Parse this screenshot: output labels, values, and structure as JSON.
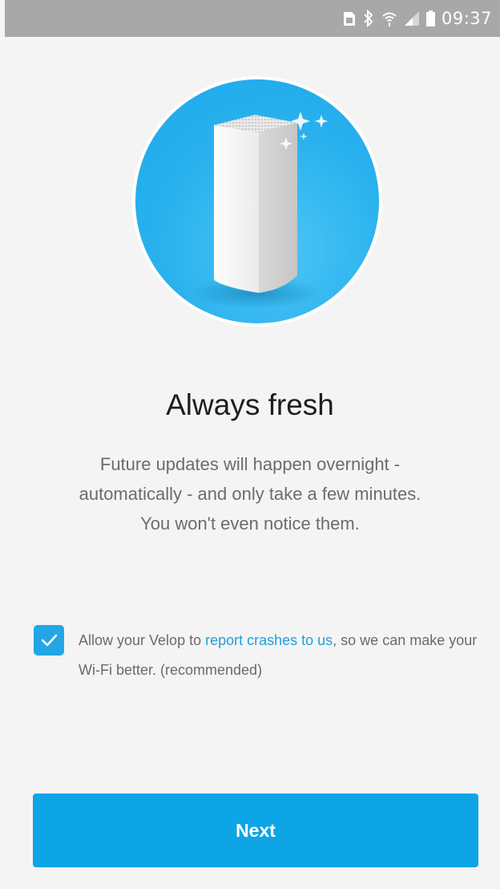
{
  "status_bar": {
    "time": "09:37",
    "icons": [
      "sim-icon",
      "bluetooth-icon",
      "wifi-icon",
      "signal-icon",
      "battery-icon"
    ]
  },
  "hero": {
    "image": "velop-node-icon",
    "colors": {
      "circle": "#1da8ea",
      "ring": "#ffffff"
    }
  },
  "title": "Always fresh",
  "description": {
    "line1": "Future updates will happen overnight - automatically - and only take a few minutes.",
    "line2": "You won't even notice them."
  },
  "consent": {
    "checked": true,
    "text_before": "Allow your Velop to ",
    "link_text": "report crashes to us",
    "text_after": ", so we can make your Wi-Fi better. (recommended)"
  },
  "next_button": {
    "label": "Next"
  },
  "colors": {
    "accent": "#0ea5e6",
    "link": "#1f9fdd",
    "background": "#f4f4f4"
  }
}
